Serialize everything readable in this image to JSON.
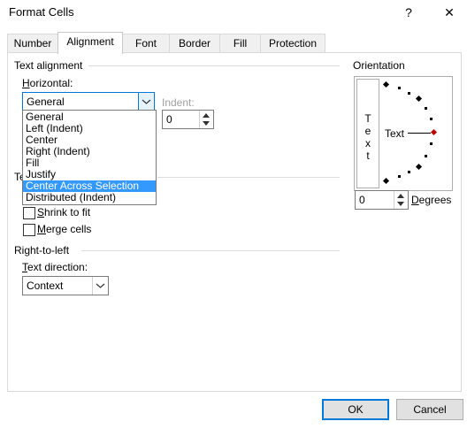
{
  "window": {
    "title": "Format Cells",
    "help_glyph": "?",
    "close_glyph": "✕"
  },
  "tabs": [
    {
      "label": "Number"
    },
    {
      "label": "Alignment"
    },
    {
      "label": "Font"
    },
    {
      "label": "Border"
    },
    {
      "label": "Fill"
    },
    {
      "label": "Protection"
    }
  ],
  "text_alignment": {
    "group_label": "Text alignment",
    "horizontal_label_u": "H",
    "horizontal_label_rest": "orizontal:",
    "horizontal_value": "General",
    "indent_label": "Indent:",
    "indent_value": "0",
    "horizontal_options": [
      "General",
      "Left (Indent)",
      "Center",
      "Right (Indent)",
      "Fill",
      "Justify",
      "Center Across Selection",
      "Distributed (Indent)"
    ],
    "selected_option": "Center Across Selection"
  },
  "text_control": {
    "group_label_fragment": "Te",
    "shrink_u": "S",
    "shrink_rest": "hrink to fit",
    "merge_u": "M",
    "merge_rest": "erge cells"
  },
  "rtl": {
    "group_label": "Right-to-left",
    "direction_label_u": "T",
    "direction_label_rest": "ext direction:",
    "direction_value": "Context"
  },
  "orientation": {
    "group_label": "Orientation",
    "vertical_chars": [
      "T",
      "e",
      "x",
      "t"
    ],
    "dial_label": "Text",
    "degrees_value": "0",
    "degrees_label_u": "D",
    "degrees_label_rest": "egrees"
  },
  "footer": {
    "ok": "OK",
    "cancel": "Cancel"
  }
}
